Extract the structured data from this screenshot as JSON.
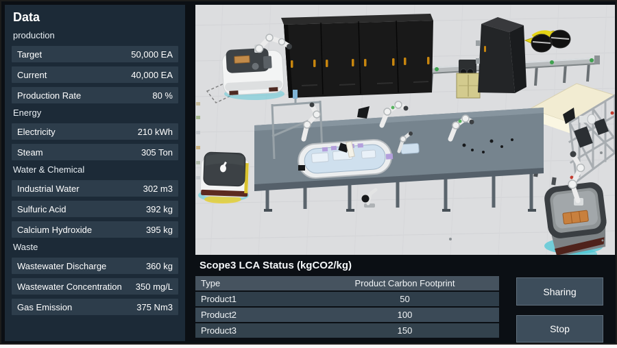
{
  "sidebar": {
    "title": "Data",
    "sections": [
      {
        "header": "production",
        "rows": [
          {
            "label": "Target",
            "value": "50,000 EA"
          },
          {
            "label": "Current",
            "value": "40,000 EA"
          },
          {
            "label": "Production Rate",
            "value": "80 %"
          }
        ]
      },
      {
        "header": "Energy",
        "rows": [
          {
            "label": "Electricity",
            "value": "210 kWh"
          },
          {
            "label": "Steam",
            "value": "305 Ton"
          }
        ]
      },
      {
        "header": "Water & Chemical",
        "rows": [
          {
            "label": "Industrial Water",
            "value": "302 m3"
          },
          {
            "label": "Sulfuric Acid",
            "value": "392 kg"
          },
          {
            "label": "Calcium Hydroxide",
            "value": "395 kg"
          }
        ]
      },
      {
        "header": "Waste",
        "rows": [
          {
            "label": "Wastewater Discharge",
            "value": "360 kg"
          },
          {
            "label": "Wastewater Concentration",
            "value": "350 mg/L"
          },
          {
            "label": "Gas Emission",
            "value": "375 Nm3"
          }
        ]
      }
    ]
  },
  "viewport3d": {
    "floor_color": "#dcdddf",
    "objects": [
      "storage-cabinet-bank",
      "storage-cabinet-single",
      "agv-robot-with-arm",
      "agv-robot-lidded",
      "agv-robot-carrying-box",
      "assembly-line-oval-track",
      "overhead-conveyor",
      "coil-handling-machine",
      "caged-inspection-machine"
    ]
  },
  "lca_panel": {
    "title": "Scope3 LCA Status (kgCO2/kg)",
    "columns": [
      "Type",
      "Product Carbon Footprint"
    ],
    "rows": [
      {
        "type": "Product1",
        "value": "50"
      },
      {
        "type": "Product2",
        "value": "100"
      },
      {
        "type": "Product3",
        "value": "150"
      }
    ]
  },
  "actions": {
    "sharing": "Sharing",
    "stop": "Stop"
  },
  "colors": {
    "sidebar_bg": "#1c2a37",
    "row_bg": "#2d3d4b",
    "panel_bg": "#0b0f14",
    "table_header_bg": "#46535f",
    "button_bg": "#3d4d5b",
    "accent_teal": "#45c6d6",
    "accent_orange": "#c8803e",
    "handle_gold": "#c8860e"
  }
}
